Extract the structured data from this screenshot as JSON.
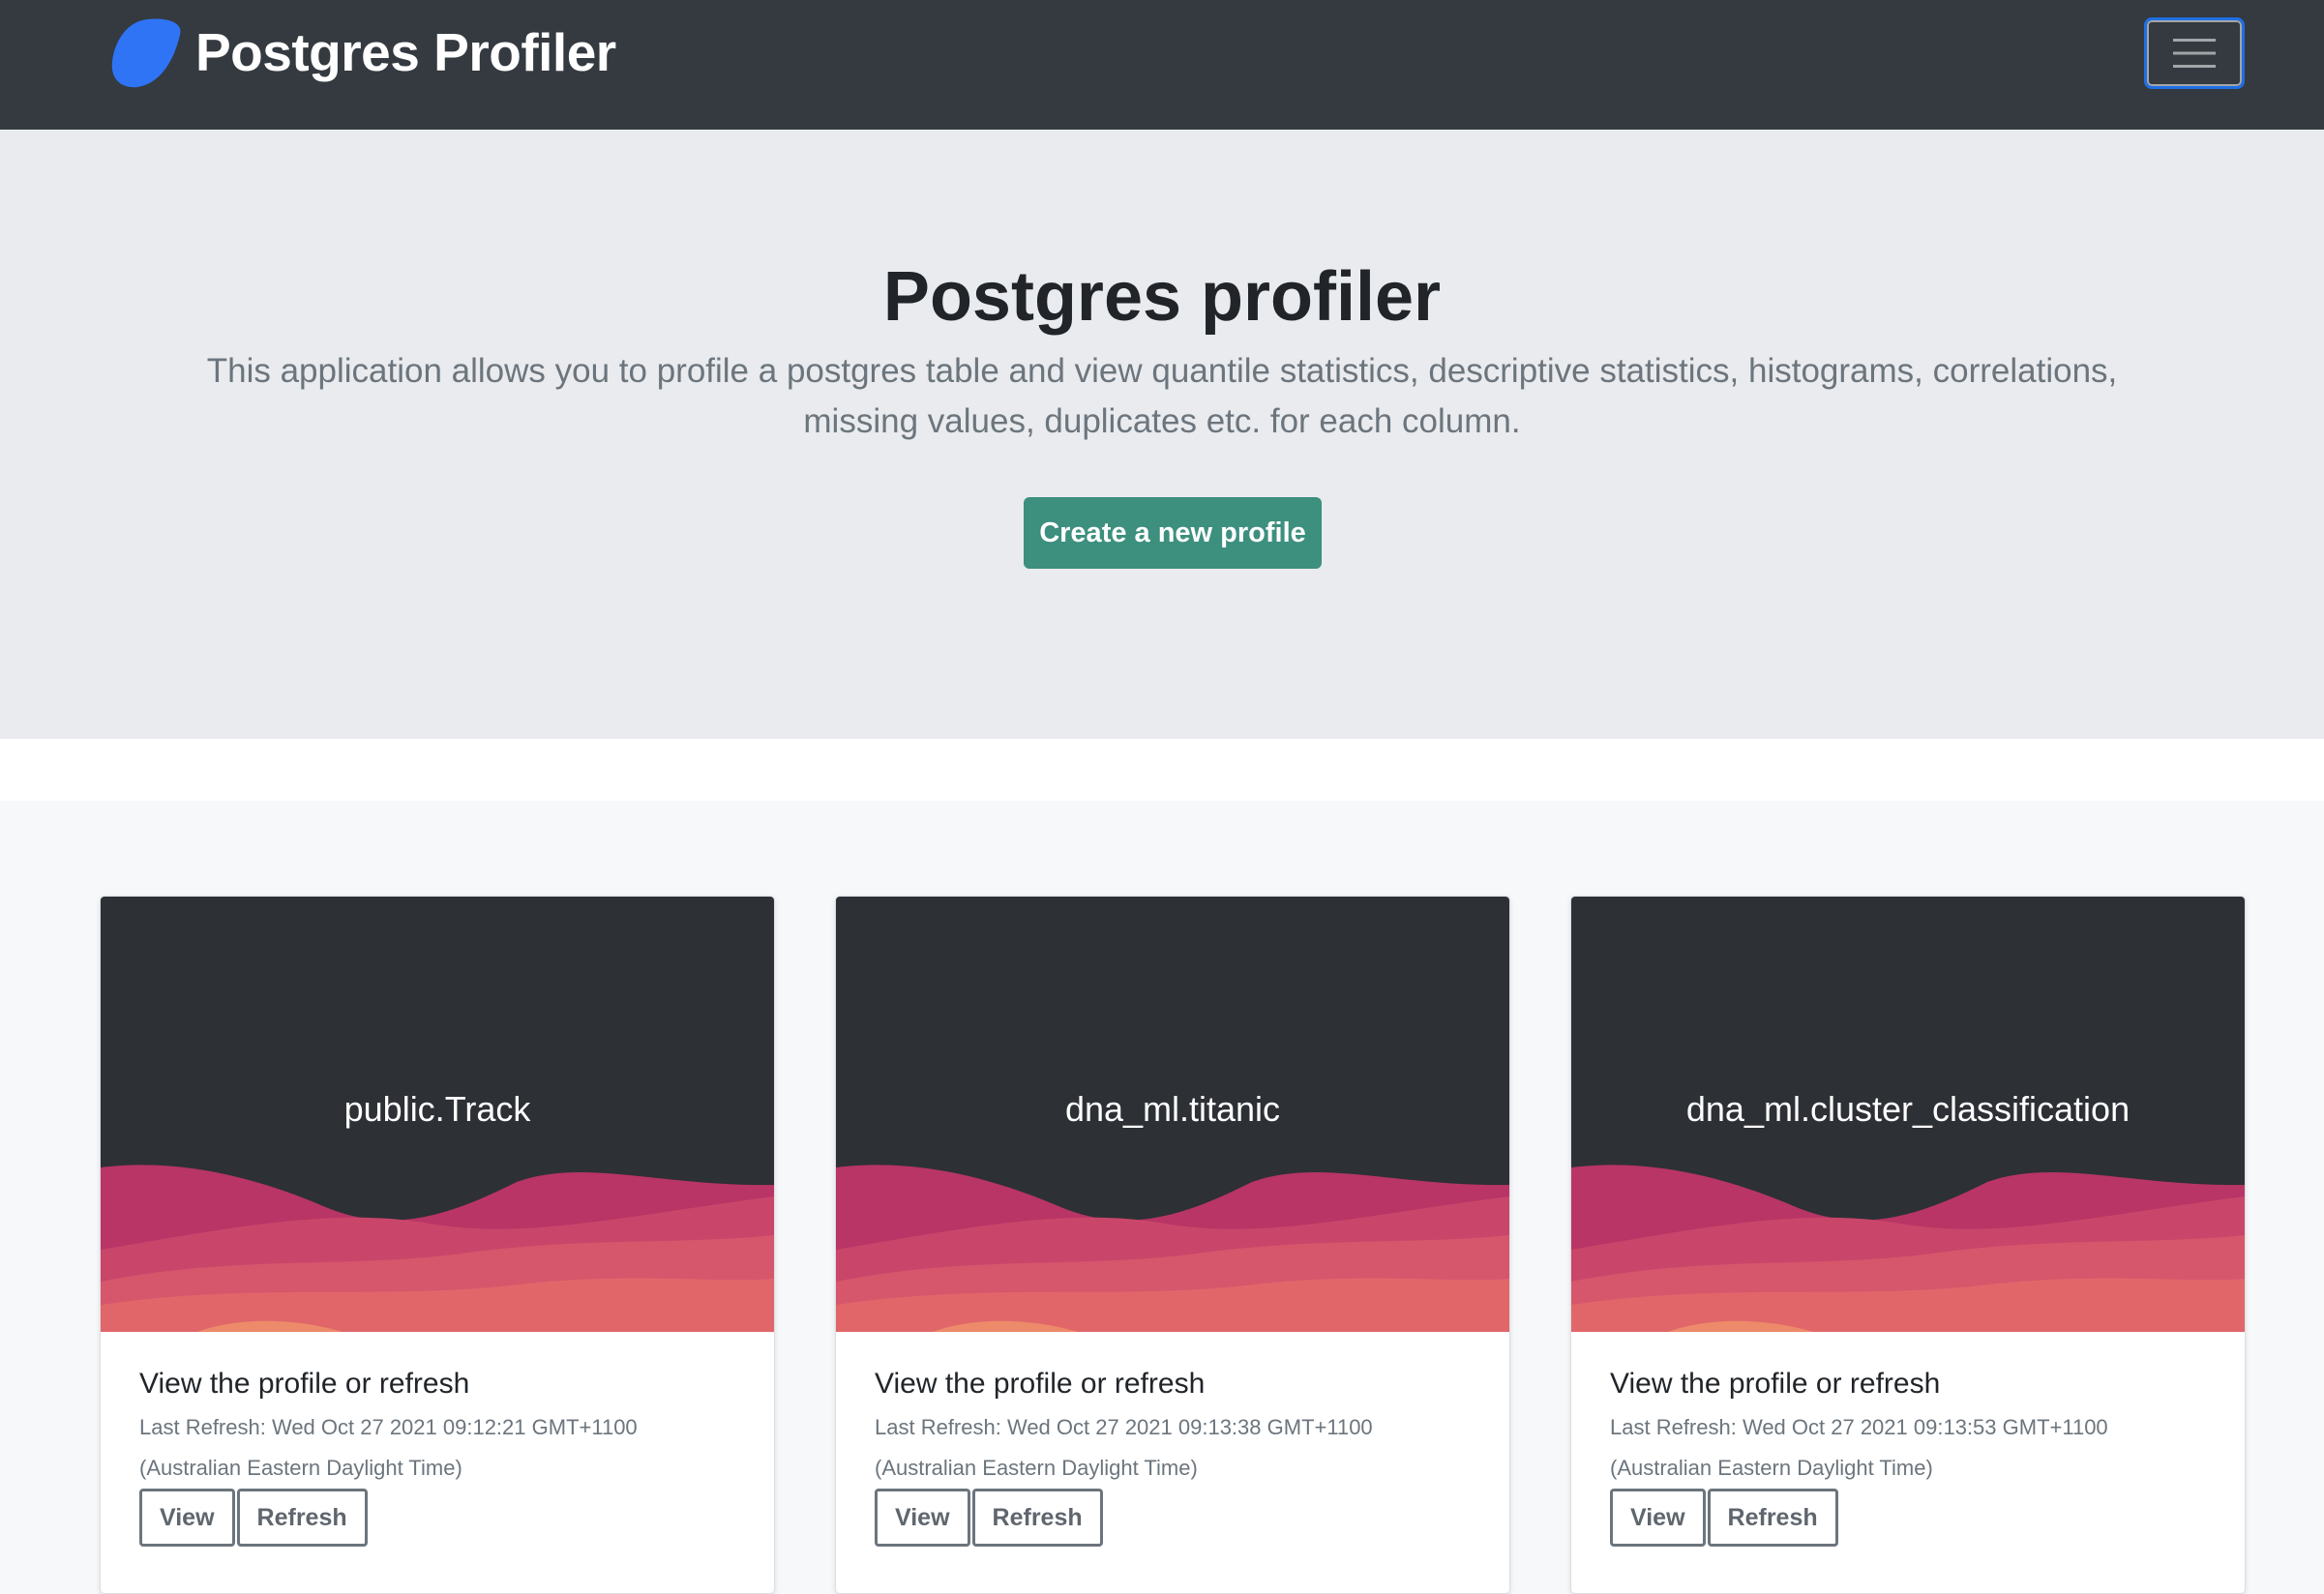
{
  "navbar": {
    "brand_name": "Postgres Profiler",
    "logo_icon": "postgres-leaf-logo",
    "menu_icon": "hamburger-icon",
    "logo_color": "#2f74f5",
    "background": "#343a40"
  },
  "hero": {
    "title": "Postgres profiler",
    "lead": "This application allows you to profile a postgres table and view quantile statistics, descriptive statistics, histograms, correlations, missing values, duplicates etc. for each column.",
    "create_button_label": "Create a new profile",
    "accent_color": "#3d8f7e"
  },
  "profiles": [
    {
      "table": "public.Track",
      "description": "View the profile or refresh",
      "last_refresh": "Last Refresh: Wed Oct 27 2021 09:12:21 GMT+1100",
      "timezone": "(Australian Eastern Daylight Time)",
      "view_label": "View",
      "refresh_label": "Refresh"
    },
    {
      "table": "dna_ml.titanic",
      "description": "View the profile or refresh",
      "last_refresh": "Last Refresh: Wed Oct 27 2021 09:13:38 GMT+1100",
      "timezone": "(Australian Eastern Daylight Time)",
      "view_label": "View",
      "refresh_label": "Refresh"
    },
    {
      "table": "dna_ml.cluster_classification",
      "description": "View the profile or refresh",
      "last_refresh": "Last Refresh: Wed Oct 27 2021 09:13:53 GMT+1100",
      "timezone": "(Australian Eastern Daylight Time)",
      "view_label": "View",
      "refresh_label": "Refresh"
    }
  ],
  "card_wave_colors": [
    "#b83566",
    "#c9466a",
    "#d6566c",
    "#e0666a",
    "#ec8a6a"
  ]
}
